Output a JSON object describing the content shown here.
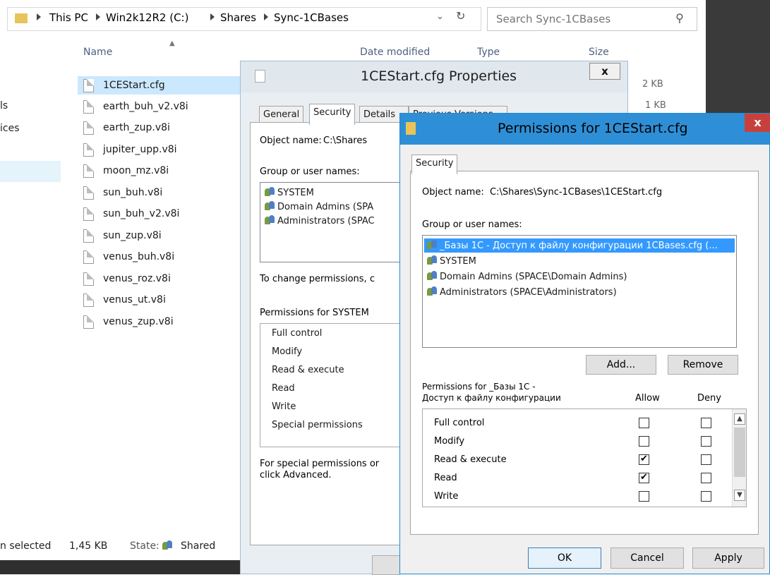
{
  "explorer": {
    "breadcrumb": [
      "This PC",
      "Win2k12R2 (C:)",
      "Shares",
      "Sync-1CBases"
    ],
    "search_placeholder": "Search Sync-1CBases",
    "columns": {
      "name": "Name",
      "date": "Date modified",
      "type": "Type",
      "size": "Size"
    },
    "files": [
      "1CEStart.cfg",
      "earth_buh_v2.v8i",
      "earth_zup.v8i",
      "jupiter_upp.v8i",
      "moon_mz.v8i",
      "sun_buh.v8i",
      "sun_buh_v2.v8i",
      "sun_zup.v8i",
      "venus_buh.v8i",
      "venus_roz.v8i",
      "venus_ut.v8i",
      "venus_zup.v8i"
    ],
    "sizes": [
      "2 KB",
      "1 KB"
    ],
    "nav_fragments": [
      "ls",
      "ices"
    ],
    "status": {
      "selected": "n selected",
      "size": "1,45 KB",
      "state_label": "State:",
      "state_value": "Shared"
    }
  },
  "properties_dialog": {
    "title": "1CEStart.cfg Properties",
    "close": "x",
    "tabs": [
      "General",
      "Security",
      "Details",
      "Previous Versions"
    ],
    "object_label": "Object name:",
    "object_value": "C:\\Shares",
    "group_label": "Group or user names:",
    "users": [
      "SYSTEM",
      "Domain Admins (SPA",
      "Administrators (SPAC"
    ],
    "change_text": "To change permissions, c",
    "perm_for": "Permissions for SYSTEM",
    "permissions": [
      "Full control",
      "Modify",
      "Read & execute",
      "Read",
      "Write",
      "Special permissions"
    ],
    "special_text_1": "For special permissions or",
    "special_text_2": "click Advanced."
  },
  "permissions_dialog": {
    "title": "Permissions for 1CEStart.cfg",
    "close": "x",
    "tab": "Security",
    "object_label": "Object name:",
    "object_value": "C:\\Shares\\Sync-1CBases\\1CEStart.cfg",
    "group_label": "Group or user names:",
    "users": [
      "_Базы 1С - Доступ к файлу конфигурации 1CBases.cfg (...",
      "SYSTEM",
      "Domain Admins (SPACE\\Domain Admins)",
      "Administrators (SPACE\\Administrators)"
    ],
    "add_button": "Add...",
    "remove_button": "Remove",
    "perm_for_1": "Permissions for _Базы 1С -",
    "perm_for_2": "Доступ к файлу конфигурации",
    "allow_label": "Allow",
    "deny_label": "Deny",
    "permissions": [
      {
        "name": "Full control",
        "allow": false,
        "deny": false
      },
      {
        "name": "Modify",
        "allow": false,
        "deny": false
      },
      {
        "name": "Read & execute",
        "allow": true,
        "deny": false
      },
      {
        "name": "Read",
        "allow": true,
        "deny": false
      },
      {
        "name": "Write",
        "allow": false,
        "deny": false
      }
    ],
    "ok_button": "OK",
    "cancel_button": "Cancel",
    "apply_button": "Apply",
    "check_glyph": "✔"
  }
}
